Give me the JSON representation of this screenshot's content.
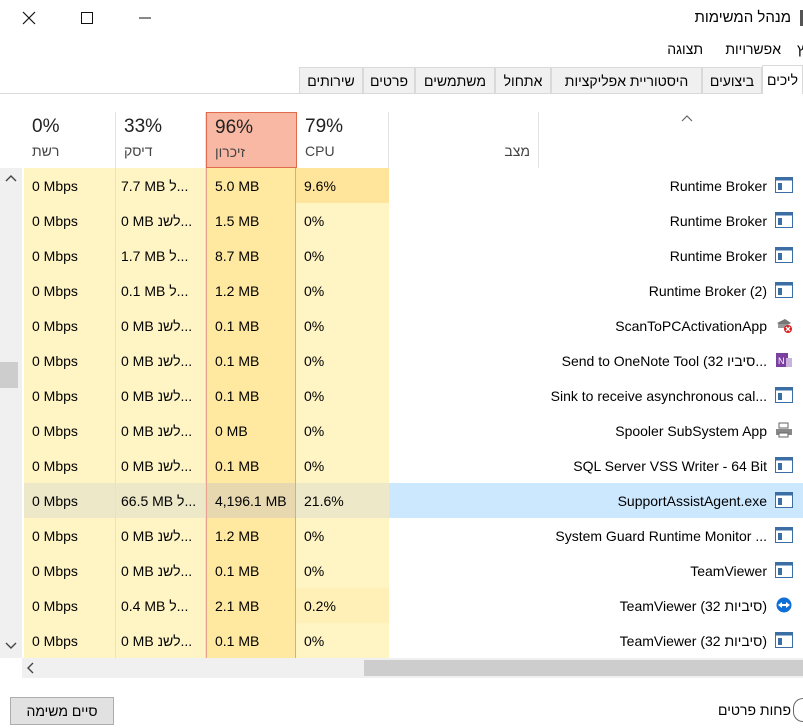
{
  "window": {
    "title": "מנהל המשימות",
    "close_glyph": "✕",
    "maximize_glyph": "☐",
    "minimize_glyph": "—"
  },
  "menu": {
    "items": [
      {
        "label": "קובץ",
        "visible_text": "ץ"
      },
      {
        "label": "אפשרויות"
      },
      {
        "label": "תצוגה"
      }
    ]
  },
  "tabs": [
    {
      "label": "ליכים",
      "active": true
    },
    {
      "label": "ביצועים"
    },
    {
      "label": "היסטוריית אפליקציות"
    },
    {
      "label": "אתחול"
    },
    {
      "label": "משתמשים"
    },
    {
      "label": "פרטים"
    },
    {
      "label": "שירותים"
    }
  ],
  "columns": {
    "network": {
      "percent": "0%",
      "label": "רשת"
    },
    "disk": {
      "percent": "33%",
      "label": "דיסק"
    },
    "memory": {
      "percent": "96%",
      "label": "זיכרון"
    },
    "cpu": {
      "percent": "79%",
      "label": "CPU"
    },
    "status": {
      "label": "מצב"
    },
    "name": {
      "sort_indicator": "^"
    }
  },
  "processes": [
    {
      "name": "Runtime Broker",
      "network": "0 Mbps",
      "disk": "7.7 MB ל...",
      "memory": "5.0 MB",
      "cpu": "9.6%",
      "icon": "app-window-icon",
      "cpu_level": "hot"
    },
    {
      "name": "Runtime Broker",
      "network": "0 Mbps",
      "disk": "0 MB לשנ...",
      "memory": "1.5 MB",
      "cpu": "0%",
      "icon": "app-window-icon"
    },
    {
      "name": "Runtime Broker",
      "network": "0 Mbps",
      "disk": "1.7 MB ל...",
      "memory": "8.7 MB",
      "cpu": "0%",
      "icon": "app-window-icon"
    },
    {
      "name": "Runtime Broker (2)",
      "network": "0 Mbps",
      "disk": "0.1 MB ל...",
      "memory": "1.2 MB",
      "cpu": "0%",
      "icon": "app-window-icon"
    },
    {
      "name": "ScanToPCActivationApp",
      "network": "0 Mbps",
      "disk": "0 MB לשנ...",
      "memory": "0.1 MB",
      "cpu": "0%",
      "icon": "scan-error-icon"
    },
    {
      "name": "Send to OneNote Tool (32 סיביו...",
      "network": "0 Mbps",
      "disk": "0 MB לשנ...",
      "memory": "0.1 MB",
      "cpu": "0%",
      "icon": "onenote-icon"
    },
    {
      "name": "Sink to receive asynchronous cal...",
      "network": "0 Mbps",
      "disk": "0 MB לשנ...",
      "memory": "0.1 MB",
      "cpu": "0%",
      "icon": "app-window-icon"
    },
    {
      "name": "Spooler SubSystem App",
      "network": "0 Mbps",
      "disk": "0 MB לשנ...",
      "memory": "0 MB",
      "cpu": "0%",
      "icon": "printer-icon"
    },
    {
      "name": "SQL Server VSS Writer - 64 Bit",
      "network": "0 Mbps",
      "disk": "0 MB לשנ...",
      "memory": "0.1 MB",
      "cpu": "0%",
      "icon": "app-window-icon"
    },
    {
      "name": "SupportAssistAgent.exe",
      "network": "0 Mbps",
      "disk": "66.5 MB ל...",
      "memory": "4,196.1 MB",
      "cpu": "21.6%",
      "icon": "app-window-icon",
      "selected": true,
      "cpu_level": "hot"
    },
    {
      "name": "System Guard Runtime Monitor ...",
      "network": "0 Mbps",
      "disk": "0 MB לשנ...",
      "memory": "1.2 MB",
      "cpu": "0%",
      "icon": "app-window-icon"
    },
    {
      "name": "TeamViewer",
      "network": "0 Mbps",
      "disk": "0 MB לשנ...",
      "memory": "0.1 MB",
      "cpu": "0%",
      "icon": "app-window-icon"
    },
    {
      "name": "TeamViewer (32 סיביות)",
      "network": "0 Mbps",
      "disk": "0.4 MB ל...",
      "memory": "2.1 MB",
      "cpu": "0.2%",
      "icon": "teamviewer-icon",
      "cpu_level": "warm"
    },
    {
      "name": "TeamViewer (32 סיביות)",
      "network": "0 Mbps",
      "disk": "0 MB לשנ...",
      "memory": "0.1 MB",
      "cpu": "0%",
      "icon": "app-window-icon"
    }
  ],
  "footer": {
    "end_task": "סיים משימה",
    "fewer_details": "פחות פרטים"
  },
  "colors": {
    "memory_header": "#f9b8a3",
    "heat_light": "#fff4c4",
    "heat_medium": "#ffe49b",
    "selection": "#cce8ff"
  }
}
